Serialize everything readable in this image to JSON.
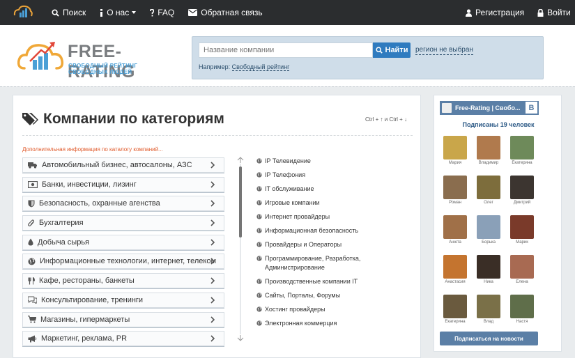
{
  "topnav": {
    "search": "Поиск",
    "about": "О нас",
    "faq": "FAQ",
    "feedback": "Обратная связь",
    "register": "Регистрация",
    "login": "Войти"
  },
  "brand": {
    "name": "FREE-RATING",
    "tagline": "СВОБОДНЫЙ РЕЙТИНГ СВОБОДНЫХ ЛЮДЕЙ"
  },
  "search": {
    "placeholder": "Название компании",
    "button": "Найти",
    "region": "регион не выбран",
    "example_prefix": "Например:",
    "example_link": "Свободный рейтинг"
  },
  "main": {
    "title": "Компании по категориям",
    "hint": "Ctrl + ↑ и Ctrl + ↓",
    "info": "Дополнительная информация по каталогу компаний...",
    "categories": [
      {
        "label": "Автомобильный бизнес, автосалоны, АЗС",
        "icon": "truck-icon"
      },
      {
        "label": "Банки, инвестиции, лизинг",
        "icon": "money-icon"
      },
      {
        "label": "Безопасность, охранные агенства",
        "icon": "shield-icon"
      },
      {
        "label": "Бухгалтерия",
        "icon": "paperclip-icon"
      },
      {
        "label": "Добыча сырья",
        "icon": "drop-icon"
      },
      {
        "label": "Информационные технологии, интернет, телеком",
        "icon": "globe-icon"
      },
      {
        "label": "Кафе, рестораны, банкеты",
        "icon": "cutlery-icon"
      },
      {
        "label": "Консультирование, тренинги",
        "icon": "comments-icon"
      },
      {
        "label": "Магазины, гипермаркеты",
        "icon": "cart-icon"
      },
      {
        "label": "Маркетинг, реклама, PR",
        "icon": "bullhorn-icon"
      }
    ],
    "subcategories": [
      "IP Телевидение",
      "IP Телефония",
      "IT обслуживание",
      "Игровые компании",
      "Интернет провайдеры",
      "Информационная безопасность",
      "Провайдеры и Операторы",
      "Программирование, Разработка, Администрирование",
      "Производственные компании IT",
      "Сайты, Порталы, Форумы",
      "Хостинг провайдеры",
      "Электронная коммерция"
    ]
  },
  "vk": {
    "group": "Free-Rating | Свобо...",
    "badge": "B",
    "subscribers": "Подписаны 19 человек",
    "members": [
      "Мария",
      "Владимир",
      "Екатерина",
      "Роман",
      "Олег",
      "Дмитрий",
      "Анюта",
      "Борька",
      "Марик",
      "Анастасия",
      "Ника",
      "Елена",
      "Екатерина",
      "Влад",
      "Настя"
    ],
    "photo_colors": [
      "#c9a64a",
      "#b07a4d",
      "#6e8a5a",
      "#8a6d4e",
      "#7d6d3c",
      "#3c3530",
      "#a07048",
      "#8aa0b8",
      "#7a3a2a",
      "#c4742f",
      "#3a2e26",
      "#a86a52",
      "#6a5a3e",
      "#7a7048",
      "#5f6e4a"
    ],
    "button": "Подписаться на новости"
  },
  "colors": {
    "topbar": "#2b2d2f",
    "accent": "#2f7bbf",
    "vk": "#5b7fa6",
    "info": "#e05a2b"
  }
}
